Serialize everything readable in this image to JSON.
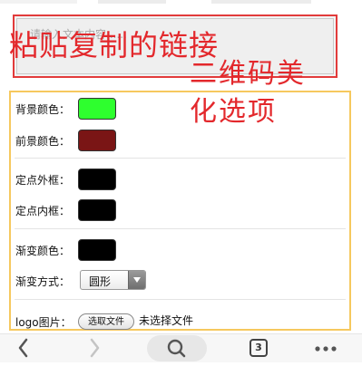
{
  "link_input": {
    "placeholder": "请输入文本内容......",
    "overlay_label": "粘贴复制的链接"
  },
  "options": {
    "rows": [
      {
        "label": "背景颜色：",
        "color": "#2eff2e"
      },
      {
        "label": "前景颜色：",
        "color": "#7a1515"
      },
      {
        "label": "定点外框：",
        "color": "#000000"
      },
      {
        "label": "定点内框：",
        "color": "#000000"
      },
      {
        "label": "渐变颜色：",
        "color": "#000000"
      }
    ],
    "gradient_mode": {
      "label": "渐变方式：",
      "selected": "圆形"
    },
    "logo": {
      "label": "logo图片：",
      "button": "选取文件",
      "status": "未选择文件"
    },
    "overlay_label_line1": "二维码美",
    "overlay_label_line2": "化选项"
  },
  "browser_bar": {
    "tab_count": "3",
    "icons": [
      "back-icon",
      "forward-icon",
      "search-icon",
      "tabs-icon",
      "more-icon"
    ]
  },
  "colors": {
    "annotation_red": "#e3282c",
    "panel_border": "#f6c85e"
  }
}
